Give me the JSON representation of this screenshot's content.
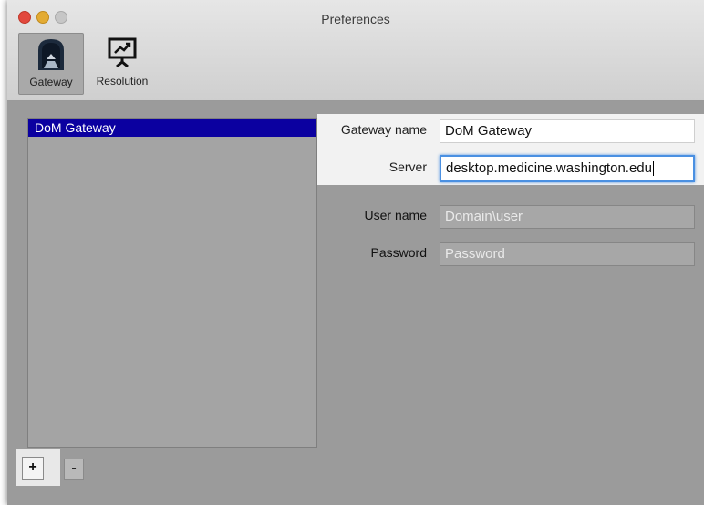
{
  "window": {
    "title": "Preferences"
  },
  "toolbar": {
    "tabs": [
      {
        "label": "Gateway",
        "icon": "gateway-icon",
        "selected": true
      },
      {
        "label": "Resolution",
        "icon": "monitor-icon",
        "selected": false
      }
    ]
  },
  "gateways": {
    "items": [
      {
        "label": "DoM Gateway",
        "selected": true
      }
    ],
    "add_label": "+",
    "remove_label": "-"
  },
  "form": {
    "gateway_name_label": "Gateway name",
    "gateway_name_value": "DoM Gateway",
    "server_label": "Server",
    "server_value": "desktop.medicine.washington.edu",
    "username_label": "User name",
    "username_placeholder": "Domain\\user",
    "password_label": "Password",
    "password_placeholder": "Password"
  },
  "colors": {
    "selection": "#0b00a0",
    "focus_ring": "#4a90e2",
    "close": "#e2483d",
    "minimize": "#e3ab33"
  }
}
